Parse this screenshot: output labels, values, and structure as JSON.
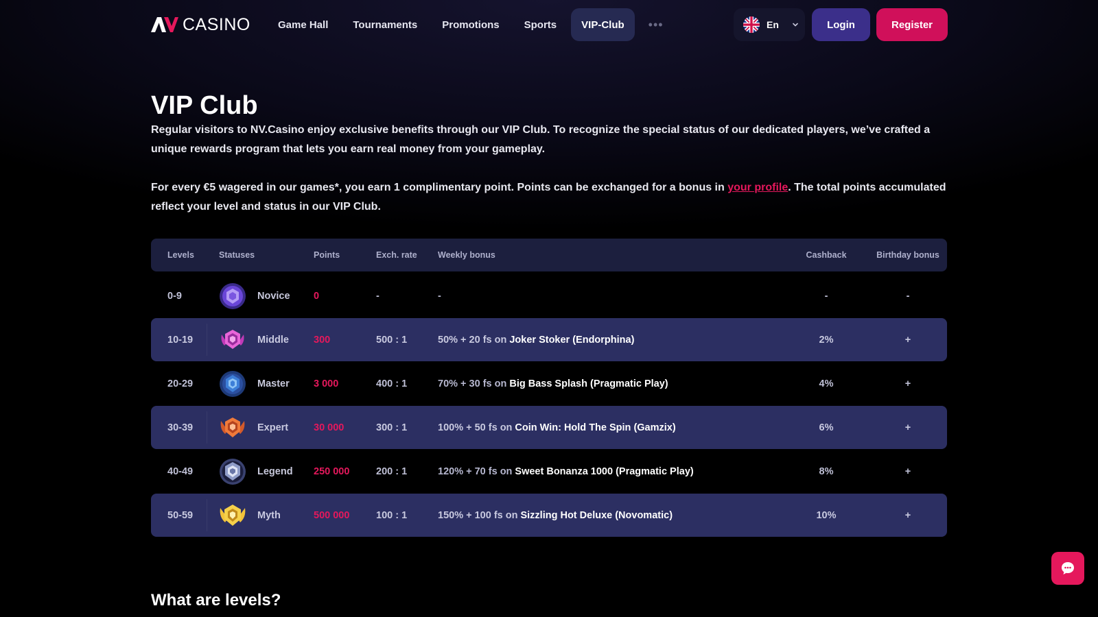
{
  "header": {
    "logo_text": "CASINO",
    "nav": [
      "Game Hall",
      "Tournaments",
      "Promotions",
      "Sports",
      "VIP-Club"
    ],
    "active_nav": "VIP-Club",
    "more_label": "•••",
    "lang_label": "En",
    "login_label": "Login",
    "register_label": "Register"
  },
  "page": {
    "title": "VIP Club",
    "intro": "Regular visitors to NV.Casino enjoy exclusive benefits through our VIP Club. To recognize the special status of our dedicated players, we’ve crafted a unique rewards program that lets you earn real money from your gameplay.",
    "points_before": "For every €5 wagered in our games*, you earn 1 complimentary point. Points can be exchanged for a bonus in ",
    "points_link": "your profile",
    "points_after": ". The total points accumulated reflect your level and status in our VIP Club.",
    "section2_title": "What are levels?"
  },
  "table": {
    "headers": {
      "levels": "Levels",
      "statuses": "Statuses",
      "points": "Points",
      "rate": "Exch. rate",
      "bonus": "Weekly bonus",
      "cashback": "Cashback",
      "birthday": "Birthday bonus"
    },
    "rows": [
      {
        "level": "0-9",
        "status": "Novice",
        "points": "0",
        "rate": "-",
        "bonus_text": "-",
        "bonus_game": "",
        "cashback": "-",
        "birthday": "-"
      },
      {
        "level": "10-19",
        "status": "Middle",
        "points": "300",
        "rate": "500 : 1",
        "bonus_text": "50% + 20 fs on",
        "bonus_game": "Joker Stoker (Endorphina)",
        "cashback": "2%",
        "birthday": "+"
      },
      {
        "level": "20-29",
        "status": "Master",
        "points": "3 000",
        "rate": "400 : 1",
        "bonus_text": "70% + 30 fs on",
        "bonus_game": "Big Bass Splash (Pragmatic Play)",
        "cashback": "4%",
        "birthday": "+"
      },
      {
        "level": "30-39",
        "status": "Expert",
        "points": "30 000",
        "rate": "300 : 1",
        "bonus_text": "100% + 50 fs on",
        "bonus_game": "Coin Win: Hold The Spin (Gamzix)",
        "cashback": "6%",
        "birthday": "+"
      },
      {
        "level": "40-49",
        "status": "Legend",
        "points": "250 000",
        "rate": "200 : 1",
        "bonus_text": "120% + 70 fs on",
        "bonus_game": "Sweet Bonanza 1000 (Pragmatic Play)",
        "cashback": "8%",
        "birthday": "+"
      },
      {
        "level": "50-59",
        "status": "Myth",
        "points": "500 000",
        "rate": "100 : 1",
        "bonus_text": "150% + 100 fs on",
        "bonus_game": "Sizzling Hot Deluxe (Novomatic)",
        "cashback": "10%",
        "birthday": "+"
      }
    ]
  },
  "colors": {
    "accent": "#e5185c",
    "active_nav_bg": "#262a52",
    "login_bg": "#3b2f8a",
    "row_highlight": "#2c2f62",
    "badge_novice": "#6a46d8",
    "badge_middle": "#d04fc4",
    "badge_master": "#3d7fd8",
    "badge_expert": "#f07a3a",
    "badge_legend": "#8f9cc8",
    "badge_myth": "#f2c23a"
  },
  "icons": {
    "flag": "uk-flag-icon",
    "chevron": "chevron-down-icon",
    "chat": "chat-icon",
    "badges": [
      "novice-badge-icon",
      "middle-badge-icon",
      "master-badge-icon",
      "expert-badge-icon",
      "legend-badge-icon",
      "myth-badge-icon"
    ]
  }
}
